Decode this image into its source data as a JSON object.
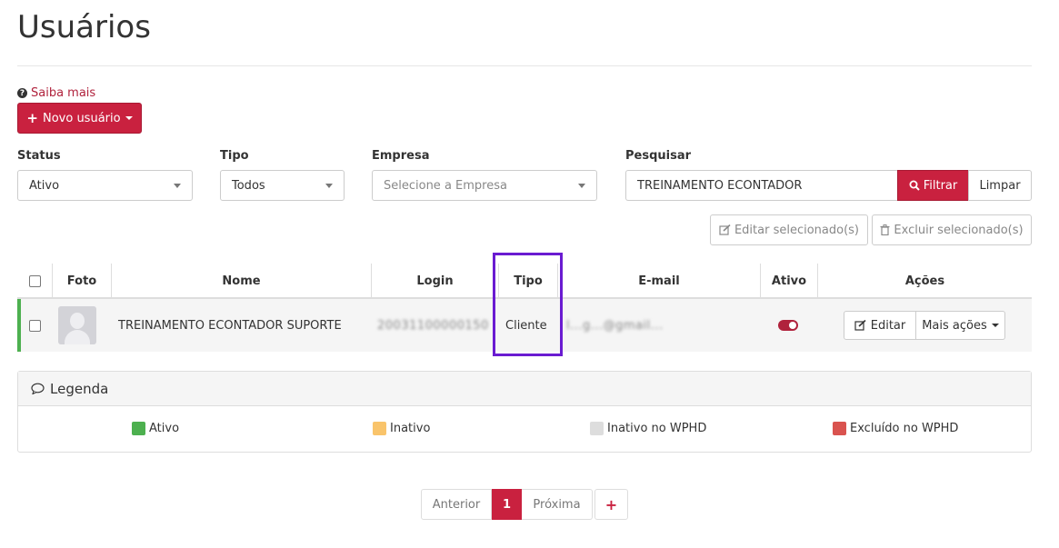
{
  "page": {
    "title": "Usuários"
  },
  "help": {
    "label": "Saiba mais",
    "icon": "question-circle-icon"
  },
  "new_user_button": {
    "label": "Novo usuário",
    "icon": "plus-icon"
  },
  "filters": {
    "status": {
      "label": "Status",
      "value": "Ativo"
    },
    "tipo": {
      "label": "Tipo",
      "value": "Todos"
    },
    "empresa": {
      "label": "Empresa",
      "placeholder": "Selecione a Empresa"
    },
    "pesquisar": {
      "label": "Pesquisar",
      "value": "TREINAMENTO ECONTADOR"
    },
    "filter_button": "Filtrar",
    "clear_button": "Limpar"
  },
  "bulk_actions": {
    "edit_selected": "Editar selecionado(s)",
    "delete_selected": "Excluir selecionado(s)"
  },
  "table": {
    "headers": {
      "foto": "Foto",
      "nome": "Nome",
      "login": "Login",
      "tipo": "Tipo",
      "email": "E-mail",
      "ativo": "Ativo",
      "acoes": "Ações"
    },
    "rows": [
      {
        "nome": "TREINAMENTO ECONTADOR SUPORTE",
        "login": "20031100000150",
        "tipo": "Cliente",
        "email": "l...g...@gmail...",
        "ativo": true,
        "edit_label": "Editar",
        "more_label": "Mais ações",
        "status_color": "#4db04f"
      }
    ]
  },
  "legend": {
    "title": "Legenda",
    "items": [
      {
        "label": "Ativo",
        "color": "#4db04f"
      },
      {
        "label": "Inativo",
        "color": "#f9c46b"
      },
      {
        "label": "Inativo no WPHD",
        "color": "#dddddd"
      },
      {
        "label": "Excluído no WPHD",
        "color": "#d9534f"
      }
    ]
  },
  "pagination": {
    "prev": "Anterior",
    "current": "1",
    "next": "Próxima",
    "add": "+"
  },
  "colors": {
    "accent": "#c9213f",
    "highlight": "#6a1bd1"
  }
}
